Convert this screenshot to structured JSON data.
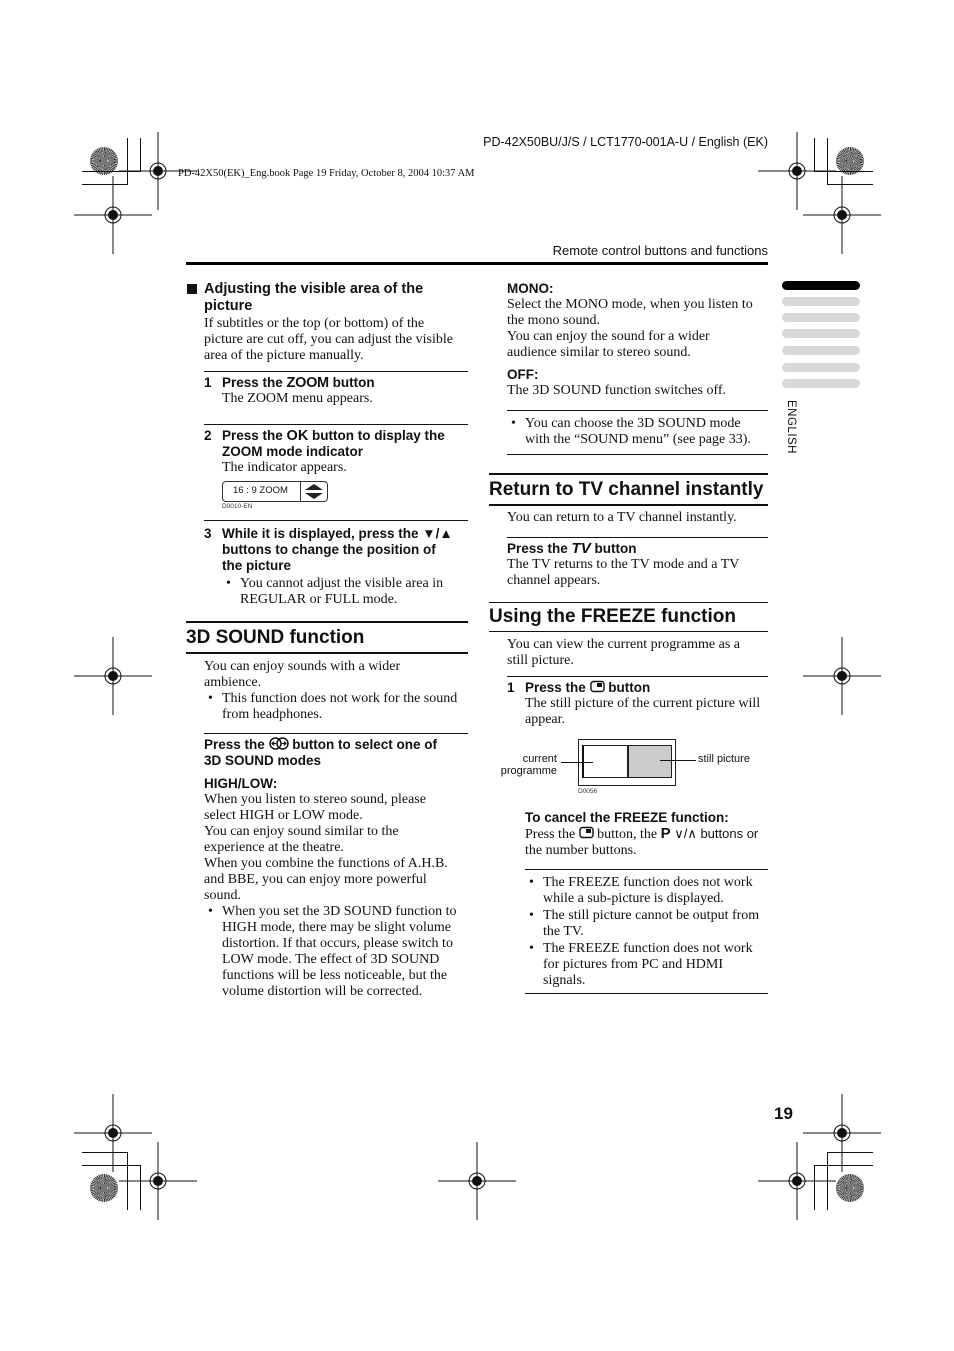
{
  "header": {
    "doc_id": "PD-42X50BU/J/S / LCT1770-001A-U / English (EK)",
    "book_line": "PD-42X50(EK)_Eng.book  Page 19  Friday, October 8, 2004  10:37 AM",
    "running_head": "Remote control buttons and functions"
  },
  "left": {
    "adjust": {
      "title_l1": "Adjusting the visible area of the",
      "title_l2": "picture",
      "body": [
        "If subtitles or the top (or bottom) of the",
        "picture are cut off, you can adjust the visible",
        "area of the picture manually."
      ],
      "step1": {
        "num": "1",
        "pre": "Press the ",
        "key": "ZOOM",
        "post": " button",
        "desc": "The ZOOM menu appears."
      },
      "step2": {
        "num": "2",
        "pre": "Press the ",
        "key": "OK",
        "post_l1": " button to display the",
        "l2": "ZOOM mode indicator",
        "desc": "The indicator appears."
      },
      "indicator": {
        "text": "16 : 9   ZOOM",
        "code": "D0010-EN"
      },
      "step3": {
        "num": "3",
        "l1": "While it is displayed, press the ▼/▲",
        "l2": "buttons to change the position of",
        "l3": "the picture",
        "bullet": [
          "You cannot adjust the visible area in",
          "REGULAR or FULL mode."
        ]
      }
    },
    "sound": {
      "title": "3D SOUND function",
      "intro": [
        "You can enjoy sounds with a wider",
        "ambience."
      ],
      "bullet": [
        "This function does not work for the sound",
        "from headphones."
      ],
      "press_pre": "Press the ",
      "press_post": " button to select one of",
      "press_l2": "3D SOUND modes",
      "highlow_label": "HIGH/LOW:",
      "highlow_body": [
        "When you listen to stereo sound, please",
        "select HIGH or LOW mode.",
        "You can enjoy sound similar to the",
        "experience at the theatre.",
        "When you combine the functions of A.H.B.",
        "and BBE, you can enjoy more powerful",
        "sound."
      ],
      "highlow_bullet": [
        "When you set the 3D SOUND function to",
        "HIGH mode, there may be slight volume",
        "distortion. If that occurs, please switch to",
        "LOW mode. The effect of 3D SOUND",
        "functions will be less noticeable, but the",
        "volume distortion will be corrected."
      ]
    }
  },
  "right": {
    "mono_label": "MONO:",
    "mono_body": [
      "Select the MONO mode, when you listen to",
      "the mono sound.",
      "You can enjoy the sound for a wider",
      "audience similar to stereo sound."
    ],
    "off_label": "OFF:",
    "off_body": "The 3D SOUND function switches off.",
    "note": [
      "You can choose the 3D SOUND mode",
      "with the “SOUND menu” (see page 33)."
    ],
    "tv": {
      "title": "Return to TV channel instantly",
      "intro": "You can return to a TV channel instantly.",
      "press_pre": "Press the ",
      "key": "TV",
      "press_post": " button",
      "desc": [
        "The TV returns to the TV mode and a TV",
        "channel appears."
      ]
    },
    "freeze": {
      "title": "Using the FREEZE function",
      "intro": [
        "You can view the current programme as a",
        "still picture."
      ],
      "step1": {
        "num": "1",
        "pre": "Press the ",
        "post": " button",
        "desc": [
          "The still picture of the current picture will",
          "appear."
        ]
      },
      "diagram": {
        "left_label_l1": "current",
        "left_label_l2": "programme",
        "right_label": "still picture",
        "code": "D0056"
      },
      "cancel_title": "To cancel the FREEZE function:",
      "cancel_l1_pre": "Press the ",
      "cancel_l1_mid": " button, the ",
      "cancel_p": "P",
      "cancel_l1_post": " ∨/∧ buttons or",
      "cancel_l2": "the number buttons.",
      "notes": [
        [
          "The FREEZE function does not work",
          "while a sub-picture is displayed."
        ],
        [
          "The still picture cannot be output from",
          "the TV."
        ],
        [
          "The FREEZE function does not work",
          "for pictures from PC and HDMI",
          "signals."
        ]
      ]
    }
  },
  "side": {
    "language": "ENGLISH",
    "tab_count": 7,
    "active_tab": 0
  },
  "footer": {
    "page_number": "19"
  }
}
